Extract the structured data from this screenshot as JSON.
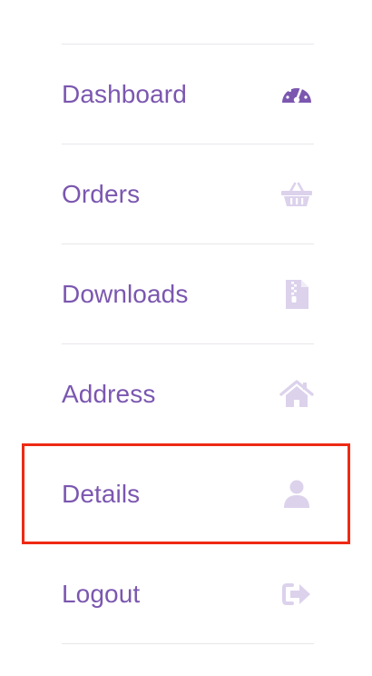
{
  "nav": {
    "items": [
      {
        "label": "Dashboard",
        "icon": "dashboard-gauge-icon",
        "active": true
      },
      {
        "label": "Orders",
        "icon": "basket-icon",
        "active": false
      },
      {
        "label": "Downloads",
        "icon": "zip-file-icon",
        "active": false
      },
      {
        "label": "Address",
        "icon": "home-icon",
        "active": false
      },
      {
        "label": "Details",
        "icon": "user-icon",
        "active": false,
        "highlighted": true
      },
      {
        "label": "Logout",
        "icon": "sign-out-icon",
        "active": false
      }
    ]
  },
  "colors": {
    "label": "#7b57b0",
    "active_icon": "#7b57b0",
    "inactive_icon": "#dcd2ec",
    "divider": "#e8e6ea",
    "highlight_border": "#ee2a14"
  }
}
